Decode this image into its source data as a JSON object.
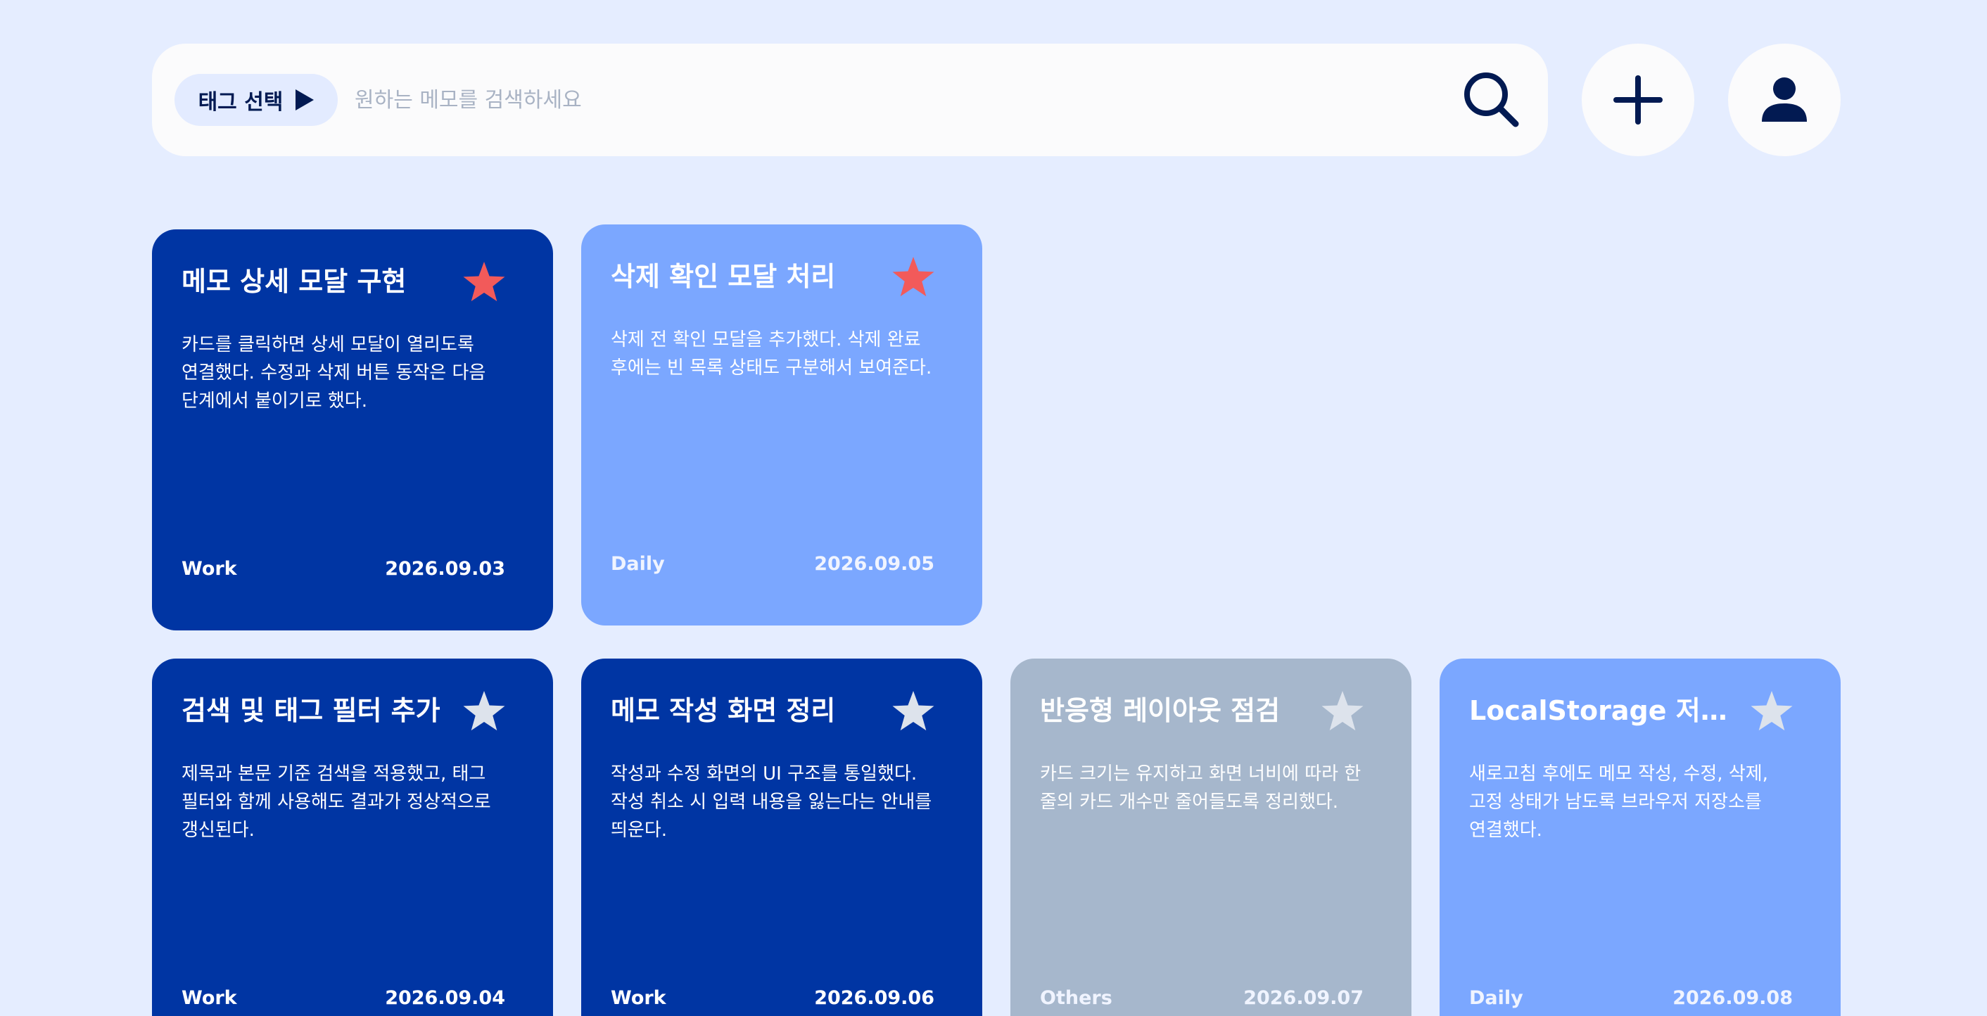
{
  "search": {
    "tag_select_label": "태그 선택",
    "placeholder": "원하는 메모를 검색하세요",
    "value": ""
  },
  "colors": {
    "background": "#e5edff",
    "work_card": "#0035a3",
    "daily_card": "#7ba7ff",
    "others_card": "#a6b7cc",
    "star_active": "#f25a5a",
    "star_inactive": "#dde3ec",
    "icon": "#021a52"
  },
  "cards": [
    {
      "title": "메모 상세 모달 구현",
      "body": "카드를 클릭하면 상세 모달이 열리도록 연결했다. 수정과 삭제 버튼 동작은 다음 단계에서 붙이기로 했다.",
      "tag": "Work",
      "date": "2026.09.03",
      "starred": true
    },
    {
      "title": "삭제 확인 모달 처리",
      "body": "삭제 전 확인 모달을 추가했다. 삭제 완료 후에는 빈 목록 상태도 구분해서 보여준다.",
      "tag": "Daily",
      "date": "2026.09.05",
      "starred": true
    },
    {
      "title": "검색 및 태그 필터 추가",
      "body": "제목과 본문 기준 검색을 적용했고, 태그 필터와 함께 사용해도 결과가 정상적으로 갱신된다.",
      "tag": "Work",
      "date": "2026.09.04",
      "starred": false
    },
    {
      "title": "메모 작성 화면 정리",
      "body": "작성과 수정 화면의 UI 구조를 통일했다. 작성 취소 시 입력 내용을 잃는다는 안내를 띄운다.",
      "tag": "Work",
      "date": "2026.09.06",
      "starred": false
    },
    {
      "title": "반응형 레이아웃 점검",
      "body": "카드 크기는 유지하고 화면 너비에 따라 한 줄의 카드 개수만 줄어들도록 정리했다.",
      "tag": "Others",
      "date": "2026.09.07",
      "starred": false
    },
    {
      "title": "LocalStorage 저장 ...",
      "body": "새로고침 후에도 메모 작성, 수정, 삭제, 고정 상태가 남도록 브라우저 저장소를 연결했다.",
      "tag": "Daily",
      "date": "2026.09.08",
      "starred": false
    }
  ]
}
